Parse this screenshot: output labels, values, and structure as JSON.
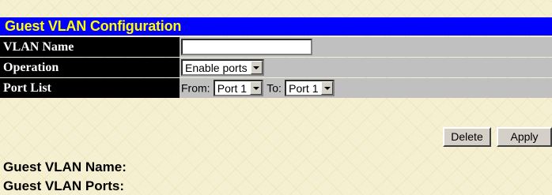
{
  "title": "Guest VLAN Configuration",
  "form": {
    "vlan_name_label": "VLAN Name",
    "vlan_name_value": "",
    "operation_label": "Operation",
    "operation_value": "Enable ports",
    "port_list_label": "Port List",
    "from_label": "From:",
    "from_value": "Port 1",
    "to_label": "To:",
    "to_value": "Port 1"
  },
  "buttons": {
    "delete": "Delete",
    "apply": "Apply"
  },
  "info": {
    "guest_vlan_name_label": "Guest VLAN Name:",
    "guest_vlan_ports_label": "Guest VLAN Ports:"
  }
}
